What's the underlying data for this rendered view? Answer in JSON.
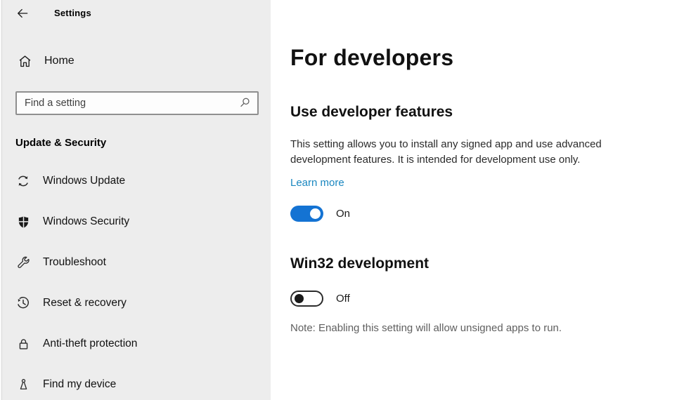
{
  "window": {
    "title": "Settings"
  },
  "sidebar": {
    "home_label": "Home",
    "search_placeholder": "Find a setting",
    "group_label": "Update & Security",
    "nav": [
      {
        "label": "Windows Update",
        "icon": "sync-icon"
      },
      {
        "label": "Windows Security",
        "icon": "shield-icon"
      },
      {
        "label": "Troubleshoot",
        "icon": "wrench-icon"
      },
      {
        "label": "Reset & recovery",
        "icon": "history-icon"
      },
      {
        "label": "Anti-theft protection",
        "icon": "lock-icon"
      },
      {
        "label": "Find my device",
        "icon": "location-pin-icon"
      }
    ]
  },
  "main": {
    "page_title": "For developers",
    "sections": [
      {
        "heading": "Use developer features",
        "description": "This setting allows you to install any signed app and use advanced development features. It is intended for development use only.",
        "link_label": "Learn more",
        "toggle_state": "on",
        "toggle_label": "On"
      },
      {
        "heading": "Win32 development",
        "toggle_state": "off",
        "toggle_label": "Off",
        "note": "Note: Enabling this setting will allow unsigned apps to run."
      }
    ]
  },
  "colors": {
    "accent": "#1473d3",
    "link": "#1a87c0",
    "sidebar_bg": "#ededed"
  }
}
